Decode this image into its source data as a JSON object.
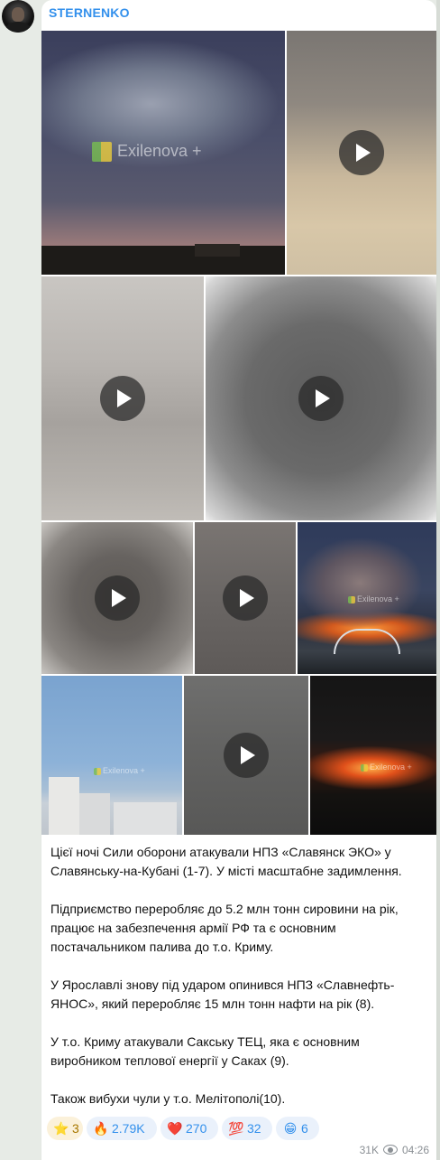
{
  "channel": {
    "name": "STERNENKO"
  },
  "watermark": "Exilenova +",
  "media": [
    {
      "kind": "photo",
      "watermark": true
    },
    {
      "kind": "video"
    },
    {
      "kind": "video"
    },
    {
      "kind": "video"
    },
    {
      "kind": "video"
    },
    {
      "kind": "video"
    },
    {
      "kind": "photo",
      "watermark": true
    },
    {
      "kind": "photo",
      "watermark": true
    },
    {
      "kind": "video"
    },
    {
      "kind": "photo",
      "watermark": true
    }
  ],
  "message": {
    "paragraphs": [
      "Цієї ночі Сили оборони атакували НПЗ «Славянск ЭКО» у Славянську-на-Кубані (1-7). У місті масштабне задимлення.",
      "Підприємство переробляє до 5.2 млн тонн сировини на рік, працює на забезпечення армії РФ та є основним постачальником палива до т.о. Криму.",
      "У Ярославлі знову під ударом опинився НПЗ «Славнефть-ЯНОС», який переробляє 15 млн тонн нафти на рік (8).",
      "У т.о. Криму атакували Сакську ТЕЦ, яка є основним виробником теплової енергії у Саках (9).",
      "Також вибухи чули у т.о. Мелітополі(10)."
    ]
  },
  "reactions": [
    {
      "emoji": "⭐",
      "count": "3",
      "name": "star"
    },
    {
      "emoji": "🔥",
      "count": "2.79K",
      "name": "fire"
    },
    {
      "emoji": "❤️",
      "count": "270",
      "name": "heart"
    },
    {
      "emoji": "💯",
      "count": "32",
      "name": "hundred"
    },
    {
      "emoji": "😁",
      "count": "6",
      "name": "grin"
    }
  ],
  "meta": {
    "views": "31K",
    "time": "04:26"
  },
  "colors": {
    "accent": "#3390ec",
    "bubble": "#ffffff",
    "background": "#e7ebe6"
  }
}
